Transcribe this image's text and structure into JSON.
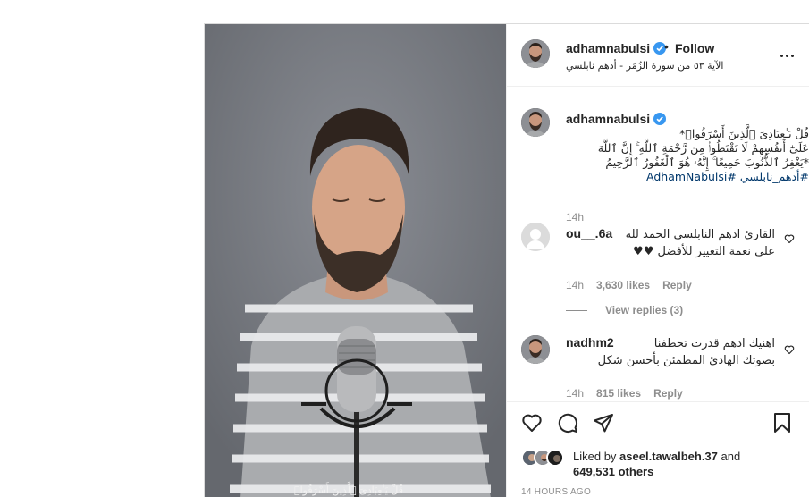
{
  "post": {
    "author": "adhamnabulsi",
    "follow_label": "Follow",
    "dot": "•",
    "subtitle_line": "الآية ٥٣ من سورة الزُمَر - أدهم نابلسي",
    "video_subtitle": "قُلْ يَـٰعِبَادِىَ ٱلَّذِينَ أَسْرَفُوا۟"
  },
  "caption": {
    "user": "adhamnabulsi",
    "line1": "قُلْ يَـٰعِبَادِىَ ٱلَّذِينَ أَسْرَفُوا۟*",
    "line2": "عَلَىٰٓ أَنفُسِهِمْ لَا تَقْنَطُوا۟ مِن رَّحْمَةِ ٱللَّهِ ۚ إِنَّ ٱللَّهَ",
    "line3": "*يَغْفِرُ ٱلذُّنُوبَ جَمِيعًا ۚ إِنَّهُۥ هُوَ ٱلْغَفُورُ ٱلرَّحِيمُ",
    "tags": "#أدهم_نابلسي #AdhamNabulsi",
    "time": "14h"
  },
  "comments": [
    {
      "user": "ou__.6a",
      "line1": "القارئ ادهم النابلسي الحمد لله",
      "line2": "على نعمة التغيير للأفضل ♥♥",
      "time": "14h",
      "likes": "3,630 likes",
      "reply": "Reply"
    },
    {
      "user": "nadhm2",
      "line1": "اهنيك ادهم قدرت تخطفنا",
      "line2": "بصوتك الهادئ المطمئن بأحسن شكل",
      "time": "14h",
      "likes": "815 likes",
      "reply": "Reply"
    }
  ],
  "view_replies": "View replies (3)",
  "likes": {
    "prefix": "Liked by ",
    "user": "aseel.tawalbeh.37",
    "and": " and",
    "others": "649,531 others"
  },
  "timestamp": "14 HOURS AGO",
  "colors": {
    "link": "#00376b",
    "muted": "#8e8e8e",
    "verified": "#3897f0",
    "heart": "#ed4956"
  },
  "icons": [
    "more-icon",
    "verified-icon",
    "heart-icon",
    "comment-icon",
    "share-icon",
    "save-icon",
    "default-avatar-icon"
  ]
}
